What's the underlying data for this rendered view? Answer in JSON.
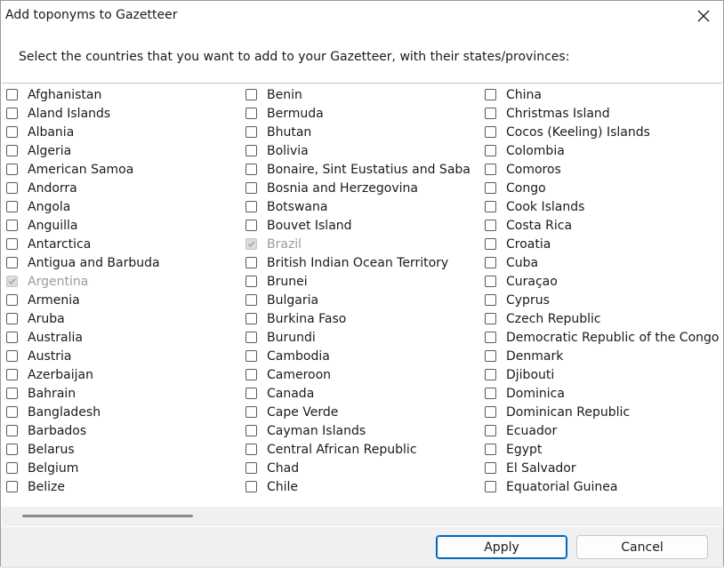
{
  "window": {
    "title": "Add toponyms to Gazetteer"
  },
  "instruction": "Select the countries that you want to add to your Gazetteer, with their states/provinces:",
  "columns": [
    [
      {
        "label": "Afghanistan",
        "state": "unchecked"
      },
      {
        "label": "Aland Islands",
        "state": "unchecked"
      },
      {
        "label": "Albania",
        "state": "unchecked"
      },
      {
        "label": "Algeria",
        "state": "unchecked"
      },
      {
        "label": "American Samoa",
        "state": "unchecked"
      },
      {
        "label": "Andorra",
        "state": "unchecked"
      },
      {
        "label": "Angola",
        "state": "unchecked"
      },
      {
        "label": "Anguilla",
        "state": "unchecked"
      },
      {
        "label": "Antarctica",
        "state": "unchecked"
      },
      {
        "label": "Antigua and Barbuda",
        "state": "unchecked"
      },
      {
        "label": "Argentina",
        "state": "checked-disabled"
      },
      {
        "label": "Armenia",
        "state": "unchecked"
      },
      {
        "label": "Aruba",
        "state": "unchecked"
      },
      {
        "label": "Australia",
        "state": "unchecked"
      },
      {
        "label": "Austria",
        "state": "unchecked"
      },
      {
        "label": "Azerbaijan",
        "state": "unchecked"
      },
      {
        "label": "Bahrain",
        "state": "unchecked"
      },
      {
        "label": "Bangladesh",
        "state": "unchecked"
      },
      {
        "label": "Barbados",
        "state": "unchecked"
      },
      {
        "label": "Belarus",
        "state": "unchecked"
      },
      {
        "label": "Belgium",
        "state": "unchecked"
      },
      {
        "label": "Belize",
        "state": "unchecked"
      }
    ],
    [
      {
        "label": "Benin",
        "state": "unchecked"
      },
      {
        "label": "Bermuda",
        "state": "unchecked"
      },
      {
        "label": "Bhutan",
        "state": "unchecked"
      },
      {
        "label": "Bolivia",
        "state": "unchecked"
      },
      {
        "label": "Bonaire, Sint Eustatius and Saba",
        "state": "unchecked"
      },
      {
        "label": "Bosnia and Herzegovina",
        "state": "unchecked"
      },
      {
        "label": "Botswana",
        "state": "unchecked"
      },
      {
        "label": "Bouvet Island",
        "state": "unchecked"
      },
      {
        "label": "Brazil",
        "state": "checked-disabled"
      },
      {
        "label": "British Indian Ocean Territory",
        "state": "unchecked"
      },
      {
        "label": "Brunei",
        "state": "unchecked"
      },
      {
        "label": "Bulgaria",
        "state": "unchecked"
      },
      {
        "label": "Burkina Faso",
        "state": "unchecked"
      },
      {
        "label": "Burundi",
        "state": "unchecked"
      },
      {
        "label": "Cambodia",
        "state": "unchecked"
      },
      {
        "label": "Cameroon",
        "state": "unchecked"
      },
      {
        "label": "Canada",
        "state": "unchecked"
      },
      {
        "label": "Cape Verde",
        "state": "unchecked"
      },
      {
        "label": "Cayman Islands",
        "state": "unchecked"
      },
      {
        "label": "Central African Republic",
        "state": "unchecked"
      },
      {
        "label": "Chad",
        "state": "unchecked"
      },
      {
        "label": "Chile",
        "state": "unchecked"
      }
    ],
    [
      {
        "label": "China",
        "state": "unchecked"
      },
      {
        "label": "Christmas Island",
        "state": "unchecked"
      },
      {
        "label": "Cocos (Keeling) Islands",
        "state": "unchecked"
      },
      {
        "label": "Colombia",
        "state": "unchecked"
      },
      {
        "label": "Comoros",
        "state": "unchecked"
      },
      {
        "label": "Congo",
        "state": "unchecked"
      },
      {
        "label": "Cook Islands",
        "state": "unchecked"
      },
      {
        "label": "Costa Rica",
        "state": "unchecked"
      },
      {
        "label": "Croatia",
        "state": "unchecked"
      },
      {
        "label": "Cuba",
        "state": "unchecked"
      },
      {
        "label": "Curaçao",
        "state": "unchecked"
      },
      {
        "label": "Cyprus",
        "state": "unchecked"
      },
      {
        "label": "Czech Republic",
        "state": "unchecked"
      },
      {
        "label": "Democratic Republic of the Congo",
        "state": "unchecked"
      },
      {
        "label": "Denmark",
        "state": "unchecked"
      },
      {
        "label": "Djibouti",
        "state": "unchecked"
      },
      {
        "label": "Dominica",
        "state": "unchecked"
      },
      {
        "label": "Dominican Republic",
        "state": "unchecked"
      },
      {
        "label": "Ecuador",
        "state": "unchecked"
      },
      {
        "label": "Egypt",
        "state": "unchecked"
      },
      {
        "label": "El Salvador",
        "state": "unchecked"
      },
      {
        "label": "Equatorial Guinea",
        "state": "unchecked"
      }
    ]
  ],
  "buttons": {
    "apply_label": "Apply",
    "cancel_label": "Cancel"
  },
  "colors": {
    "accent": "#0067c0",
    "disabled_text": "#9b9b9b",
    "footer_bg": "#f0f0f0"
  },
  "icons": {
    "close": "close-icon",
    "check": "checkmark-icon"
  }
}
